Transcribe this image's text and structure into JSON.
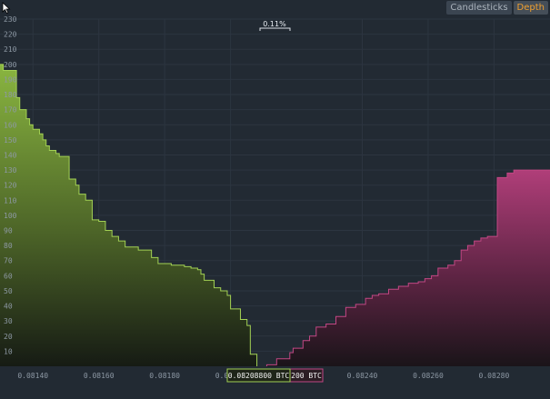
{
  "toolbar": {
    "tabs": [
      {
        "label": "Candlesticks",
        "active": false
      },
      {
        "label": "Depth",
        "active": true
      }
    ]
  },
  "chart_data": {
    "type": "area",
    "ylim": [
      0,
      230
    ],
    "xlim": [
      0.0813,
      0.08297
    ],
    "yticks": [
      10,
      20,
      30,
      40,
      50,
      60,
      70,
      80,
      90,
      100,
      110,
      120,
      130,
      140,
      150,
      160,
      170,
      180,
      190,
      200,
      210,
      220,
      230
    ],
    "xticks": [
      "0.08140",
      "0.08160",
      "0.08180",
      "0.08200",
      "0.08240",
      "0.08260",
      "0.08280"
    ],
    "spread_label": "0.11%",
    "price_labels": {
      "bid": "0.08208800 BTC",
      "ask": "0.08218200 BTC",
      "ask_visible": "200 BTC"
    },
    "grid": true,
    "colors": {
      "bid": "#a3d154",
      "ask": "#c24784",
      "bg": "#222a33"
    },
    "series": [
      {
        "name": "",
        "side": "bid",
        "x": [
          0.0813,
          0.08131,
          0.08135,
          0.08136,
          0.08136,
          0.08138,
          0.08139,
          0.0814,
          0.08142,
          0.08143,
          0.08144,
          0.08145,
          0.08147,
          0.08148,
          0.08151,
          0.08153,
          0.08154,
          0.08156,
          0.08158,
          0.0816,
          0.08162,
          0.08164,
          0.08166,
          0.08168,
          0.08172,
          0.08176,
          0.08178,
          0.08182,
          0.08186,
          0.08188,
          0.0819,
          0.08191,
          0.08192,
          0.08195,
          0.08197,
          0.08199,
          0.082,
          0.08203,
          0.08203,
          0.08205,
          0.08206,
          0.08208
        ],
        "y": [
          200,
          196,
          178,
          177,
          170,
          164,
          160,
          157,
          154,
          150,
          146,
          143,
          141,
          139,
          124,
          120,
          114,
          110,
          97,
          96,
          90,
          86,
          83,
          79,
          77,
          72,
          68,
          67,
          66,
          65,
          64,
          61,
          57,
          52,
          50,
          47,
          38,
          36,
          31,
          27,
          8,
          0
        ]
      },
      {
        "name": "",
        "side": "ask",
        "x": [
          0.08211,
          0.08214,
          0.08218,
          0.08219,
          0.08222,
          0.08224,
          0.08226,
          0.08229,
          0.08232,
          0.08235,
          0.08238,
          0.08241,
          0.08243,
          0.08245,
          0.08248,
          0.08251,
          0.08254,
          0.08257,
          0.08259,
          0.08261,
          0.08263,
          0.08266,
          0.08268,
          0.0827,
          0.08272,
          0.08274,
          0.08276,
          0.08278,
          0.08281,
          0.08284,
          0.08286,
          0.0829,
          0.08297
        ],
        "y": [
          0,
          1,
          5,
          9,
          12,
          17,
          20,
          26,
          28,
          33,
          39,
          41,
          45,
          47,
          48,
          51,
          53,
          55,
          56,
          58,
          60,
          65,
          67,
          70,
          77,
          80,
          83,
          85,
          86,
          125,
          128,
          130,
          130
        ]
      }
    ]
  }
}
